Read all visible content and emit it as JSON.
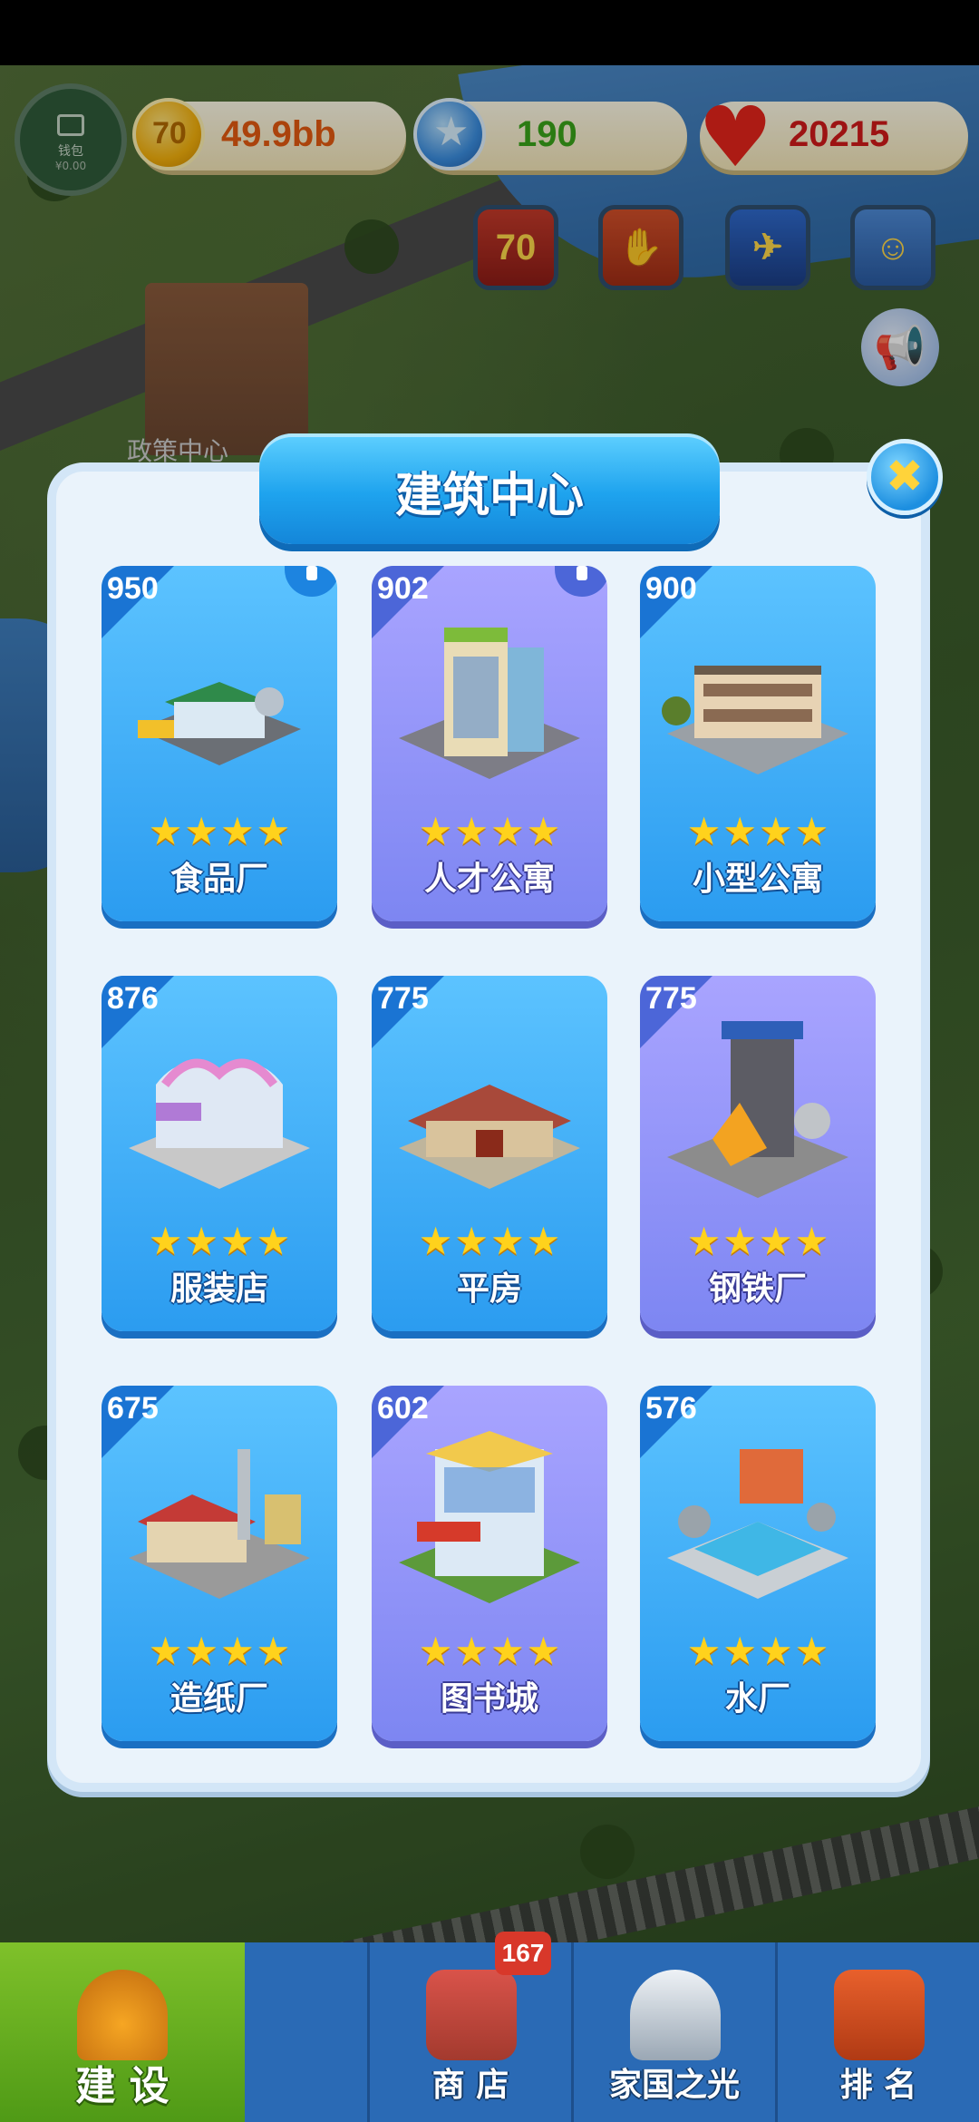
{
  "wallet": {
    "label": "钱包",
    "amount": "¥0.00"
  },
  "resources": {
    "gold": "49.9bb",
    "stars": "190",
    "hearts": "20215"
  },
  "event_buttons": [
    {
      "name": "event-70",
      "text": "70"
    },
    {
      "name": "event-handshake",
      "text": ""
    },
    {
      "name": "event-poster",
      "text": ""
    },
    {
      "name": "event-portrait",
      "text": ""
    }
  ],
  "map": {
    "label": "政策中心"
  },
  "dialog": {
    "title": "建筑中心",
    "close_icon": "close-icon",
    "buildings": [
      {
        "number": "950",
        "name": "食品厂",
        "stars": 4,
        "style": "blue",
        "locked": true
      },
      {
        "number": "902",
        "name": "人才公寓",
        "stars": 4,
        "style": "purple",
        "locked": true
      },
      {
        "number": "900",
        "name": "小型公寓",
        "stars": 4,
        "style": "blue",
        "locked": false
      },
      {
        "number": "876",
        "name": "服装店",
        "stars": 4,
        "style": "blue",
        "locked": false
      },
      {
        "number": "775",
        "name": "平房",
        "stars": 4,
        "style": "blue",
        "locked": false
      },
      {
        "number": "775",
        "name": "钢铁厂",
        "stars": 4,
        "style": "purple",
        "locked": false
      },
      {
        "number": "675",
        "name": "造纸厂",
        "stars": 4,
        "style": "blue",
        "locked": false
      },
      {
        "number": "602",
        "name": "图书城",
        "stars": 4,
        "style": "purple",
        "locked": false
      },
      {
        "number": "576",
        "name": "水厂",
        "stars": 4,
        "style": "blue",
        "locked": false
      }
    ]
  },
  "bottom_nav": {
    "items": [
      {
        "label": "建 设",
        "icon": "hardhat-icon",
        "active": true
      },
      {
        "label": "商 店",
        "icon": "shop-icon",
        "active": false
      },
      {
        "label": "家国之光",
        "icon": "rocket-icon",
        "active": false
      },
      {
        "label": "排 名",
        "icon": "ranking-icon",
        "active": false
      }
    ],
    "shop_badge": "167"
  },
  "colors": {
    "accent_blue": "#2b9cf0",
    "card_purple": "#7d86f2",
    "star_gold": "#ffd21c",
    "active_green": "#7fc12a"
  }
}
